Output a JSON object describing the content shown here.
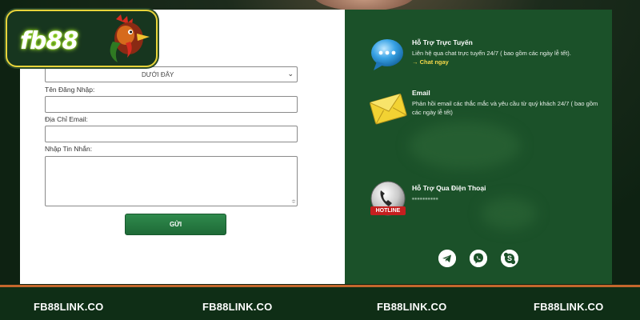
{
  "logo": {
    "text": "fb88"
  },
  "form": {
    "select_value": "DƯỚI ĐÂY",
    "username_label": "Tên Đăng Nhập:",
    "email_label": "Địa Chỉ Email:",
    "message_label": "Nhập Tin Nhắn:",
    "submit_label": "GỬI"
  },
  "support": {
    "chat": {
      "title": "Hỗ Trợ Trực Tuyến",
      "desc": "Liên hệ qua chat trực tuyến 24/7 ( bao gồm các ngày lễ tết).",
      "link": "→ Chat ngay"
    },
    "email": {
      "title": "Email",
      "desc": "Phản hồi email các thắc mắc và yêu cầu từ quý khách 24/7 ( bao gồm các ngày lễ tết)"
    },
    "phone": {
      "title": "Hỗ Trợ Qua Điện Thoại",
      "badge": "HOTLINE",
      "number": "••••••••••"
    }
  },
  "social_icons": [
    "telegram-icon",
    "viber-icon",
    "skype-icon"
  ],
  "bottom_brand": [
    "FB88LINK.CO",
    "FB88LINK.CO",
    "FB88LINK.CO",
    "FB88LINK.CO"
  ],
  "colors": {
    "panel_green": "#1b5129",
    "button_green": "#2f8a4c",
    "link_yellow": "#f6d94a",
    "strip_border": "#c4672c",
    "logo_border": "#e8d43a"
  }
}
